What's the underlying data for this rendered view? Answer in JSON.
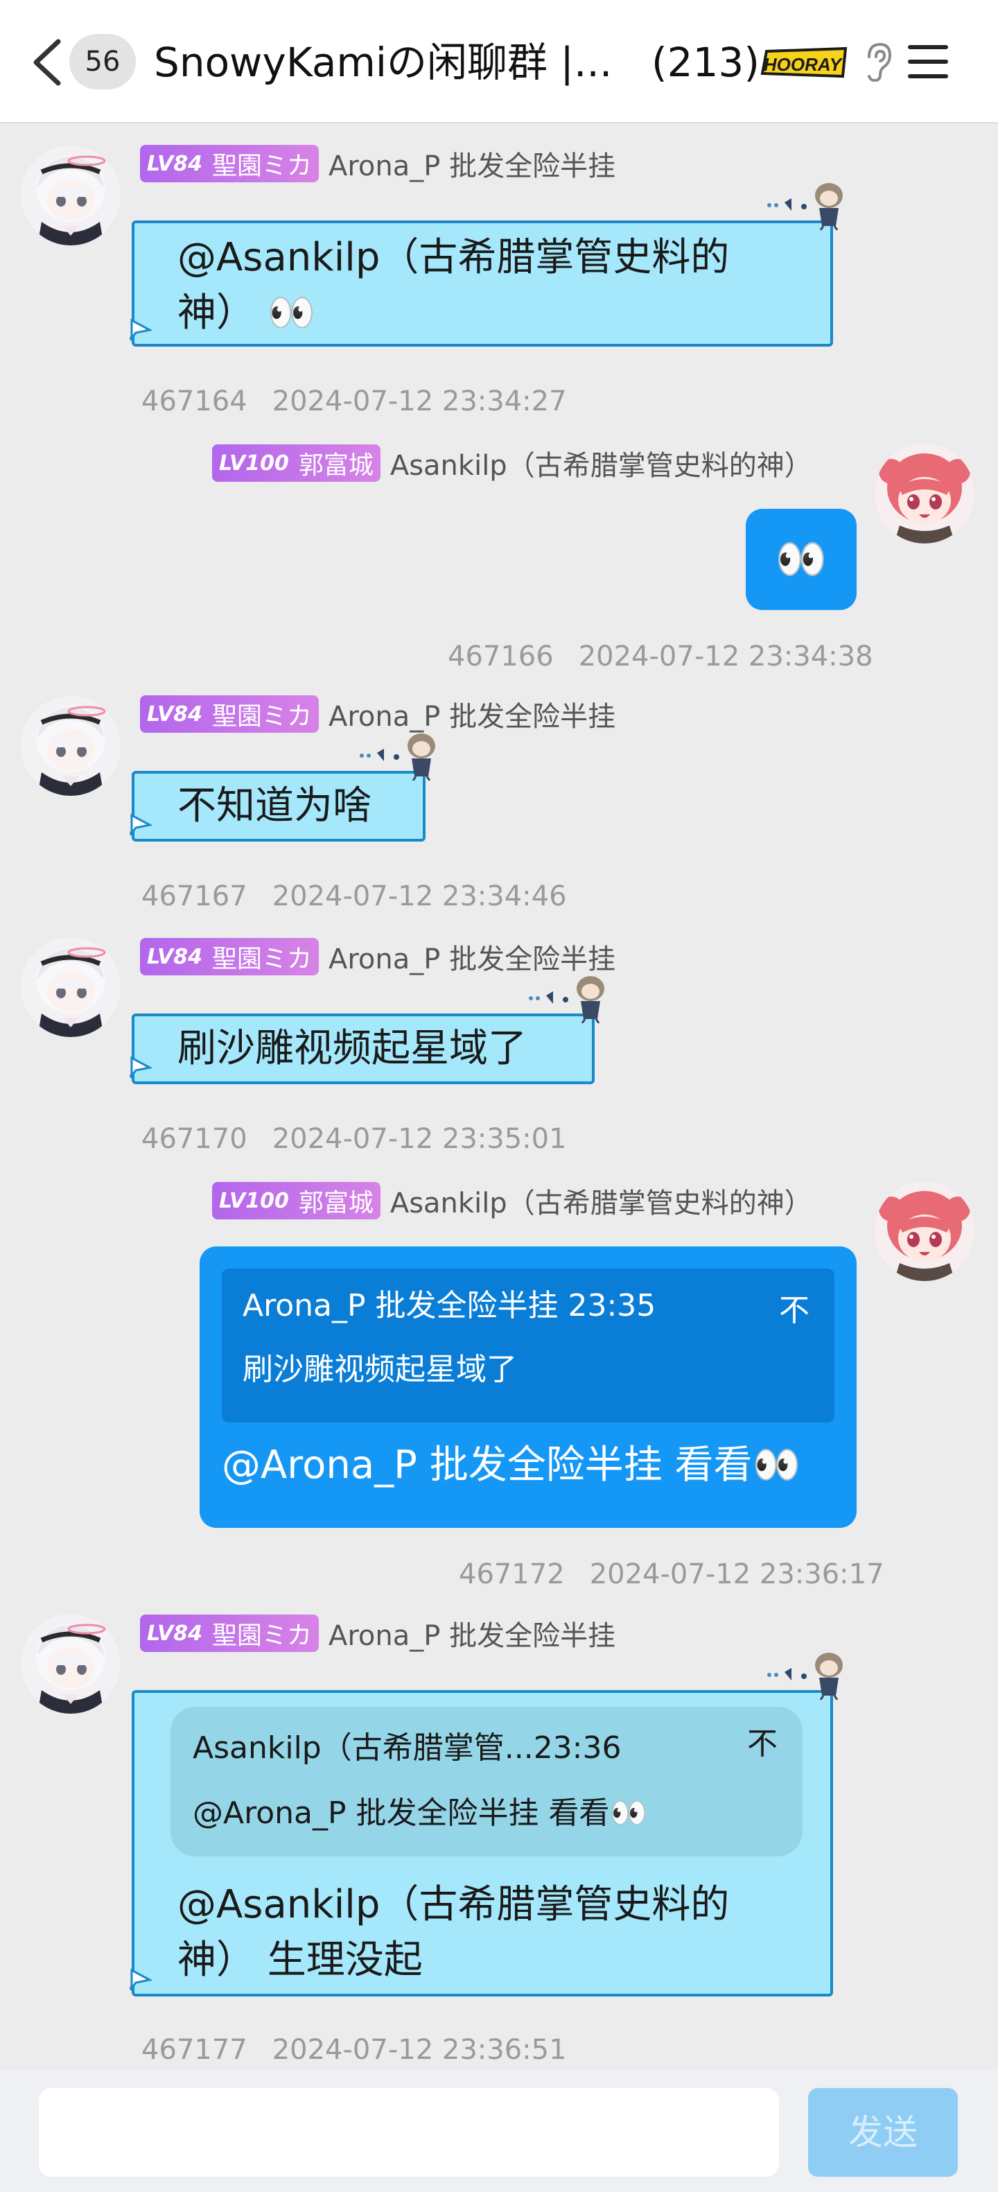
{
  "header": {
    "unread_count": "56",
    "title": "SnowyKamiの闲聊群 |...",
    "member_count": "(213)",
    "hooray_label": "HOORAY",
    "back_icon": "chevron-left-icon",
    "ear_icon": "ear-icon",
    "menu_icon": "hamburger-menu-icon"
  },
  "messages": [
    {
      "side": "left",
      "level": "LV84",
      "title": "聖園ミカ",
      "username": "Arona_P 批发全险半挂",
      "text_line1": "@Asankilp（古希腊掌管史料的",
      "text_line2": "神） 👀",
      "msg_id": "467164",
      "time": "2024-07-12 23:34:27"
    },
    {
      "side": "right",
      "level": "LV100",
      "title": "郭富城",
      "username": "Asankilp（古希腊掌管史料的神）",
      "text": "👀",
      "msg_id": "467166",
      "time": "2024-07-12 23:34:38"
    },
    {
      "side": "left",
      "level": "LV84",
      "title": "聖園ミカ",
      "username": "Arona_P 批发全险半挂",
      "text": "不知道为啥",
      "msg_id": "467167",
      "time": "2024-07-12 23:34:46"
    },
    {
      "side": "left",
      "level": "LV84",
      "title": "聖園ミカ",
      "username": "Arona_P 批发全险半挂",
      "text": "刷沙雕视频起星域了",
      "msg_id": "467170",
      "time": "2024-07-12 23:35:01"
    },
    {
      "side": "right",
      "level": "LV100",
      "title": "郭富城",
      "username": "Asankilp（古希腊掌管史料的神）",
      "quote_header": "Arona_P 批发全险半挂 23:35",
      "quote_close": "不",
      "quote_text": "刷沙雕视频起星域了",
      "text": "@Arona_P 批发全险半挂 看看👀",
      "msg_id": "467172",
      "time": "2024-07-12 23:36:17"
    },
    {
      "side": "left",
      "level": "LV84",
      "title": "聖園ミカ",
      "username": "Arona_P 批发全险半挂",
      "quote_header": "Asankilp（古希腊掌管...23:36",
      "quote_close": "不",
      "quote_text": "@Arona_P 批发全险半挂 看看👀",
      "text_line1": "@Asankilp（古希腊掌管史料的",
      "text_line2": "神） 生理没起",
      "msg_id": "467177",
      "time": "2024-07-12 23:36:51"
    }
  ],
  "composer": {
    "input_value": "",
    "send_label": "发送"
  },
  "colors": {
    "accent_blue": "#1597f5",
    "left_bubble": "#a6e8fb",
    "left_bubble_border": "#1989c8",
    "level_tag": "#c77ae8"
  }
}
